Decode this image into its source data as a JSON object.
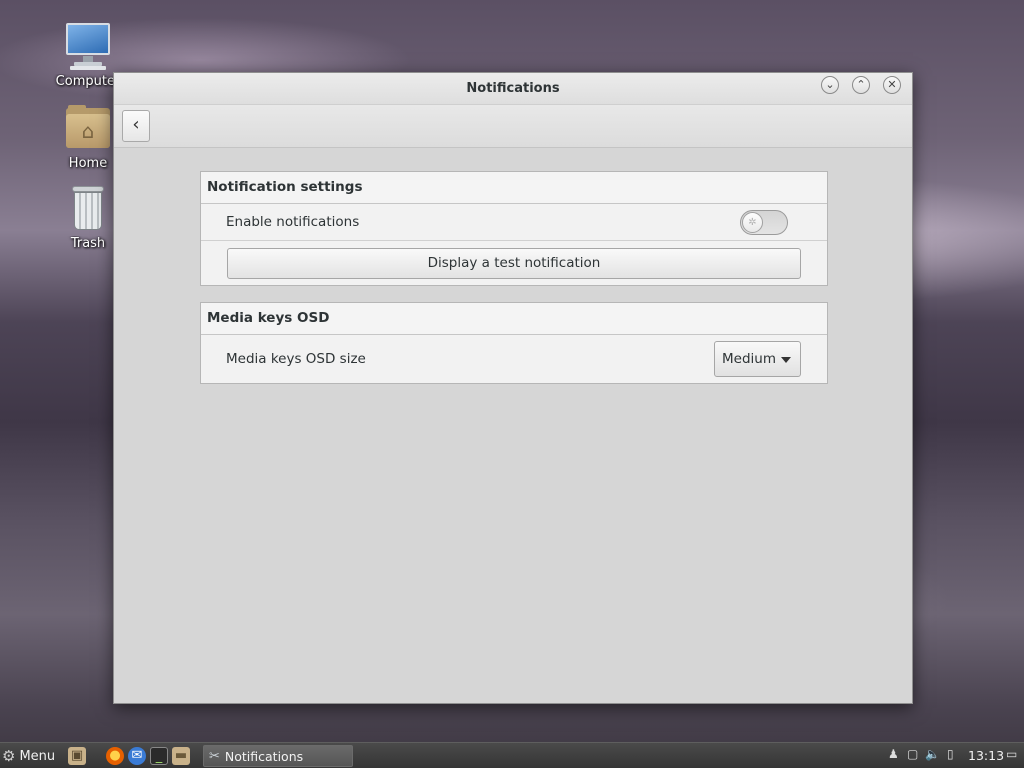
{
  "desktop": {
    "icons": [
      {
        "label": "Computer",
        "icon": "computer-icon"
      },
      {
        "label": "Home",
        "icon": "home-folder-icon"
      },
      {
        "label": "Trash",
        "icon": "trash-icon"
      }
    ]
  },
  "window": {
    "title": "Notifications",
    "controls": {
      "minimize": "⌄",
      "maximize": "⌃",
      "close": "✕"
    },
    "back_glyph": "‹"
  },
  "notification_settings": {
    "heading": "Notification settings",
    "enable_label": "Enable notifications",
    "enabled": false,
    "test_button": "Display a test notification"
  },
  "media_keys": {
    "heading": "Media keys OSD",
    "size_label": "Media keys OSD size",
    "size_value": "Medium"
  },
  "taskbar": {
    "menu_label": "Menu",
    "launchers": [
      "show-desktop-icon",
      "firefox-icon",
      "thunderbird-icon",
      "terminal-icon",
      "files-icon"
    ],
    "task_label": "Notifications",
    "tray": [
      "user-icon",
      "display-icon",
      "volume-icon",
      "battery-icon"
    ],
    "clock": "13:13"
  },
  "colors": {
    "window_bg": "#d6d6d6",
    "frame_bg": "#f2f2f2",
    "taskbar_bg": "#3f3f3f",
    "firefox": "#e66000",
    "thunderbird": "#3a7bd5"
  }
}
